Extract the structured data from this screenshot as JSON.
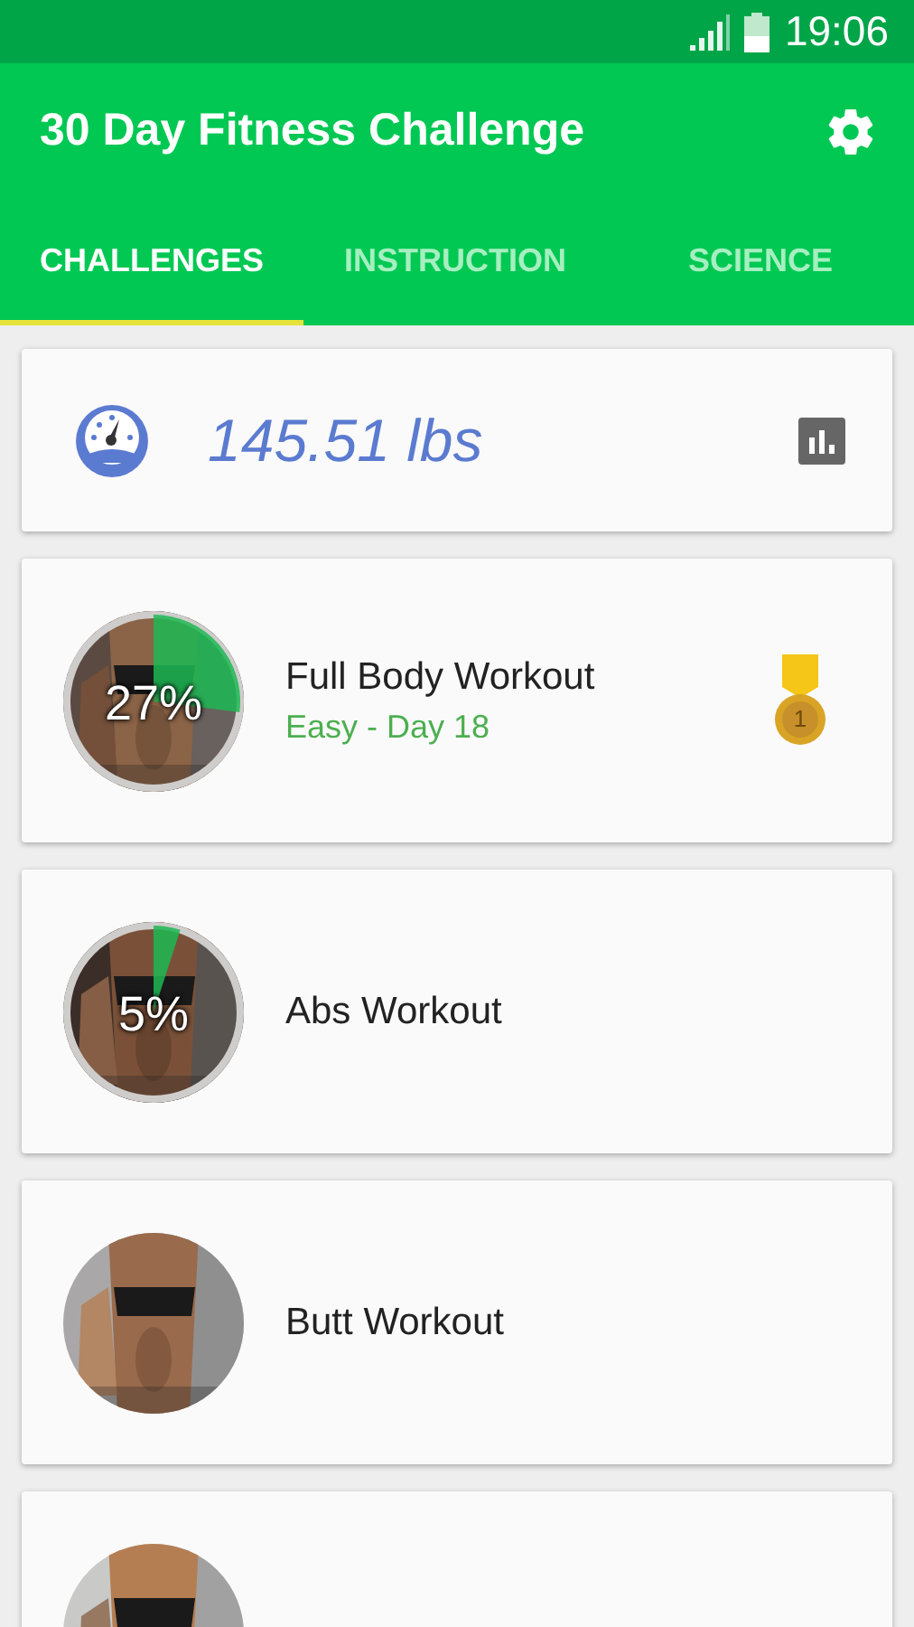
{
  "status_bar": {
    "time": "19:06"
  },
  "app_bar": {
    "title": "30 Day Fitness Challenge"
  },
  "tabs": [
    {
      "label": "CHALLENGES",
      "selected": true
    },
    {
      "label": "INSTRUCTION",
      "selected": false
    },
    {
      "label": "SCIENCE",
      "selected": false
    }
  ],
  "weight": {
    "value": "145.51 lbs"
  },
  "workouts": [
    {
      "kind": "progress",
      "title": "Full Body Workout",
      "subtitle": "Easy - Day 18",
      "progress": {
        "label": "27%"
      },
      "medal": "1"
    },
    {
      "kind": "progress",
      "title": "Abs Workout",
      "progress": {
        "label": "5%"
      }
    },
    {
      "kind": "plain",
      "title": "Butt Workout"
    },
    {
      "kind": "picture"
    }
  ]
}
